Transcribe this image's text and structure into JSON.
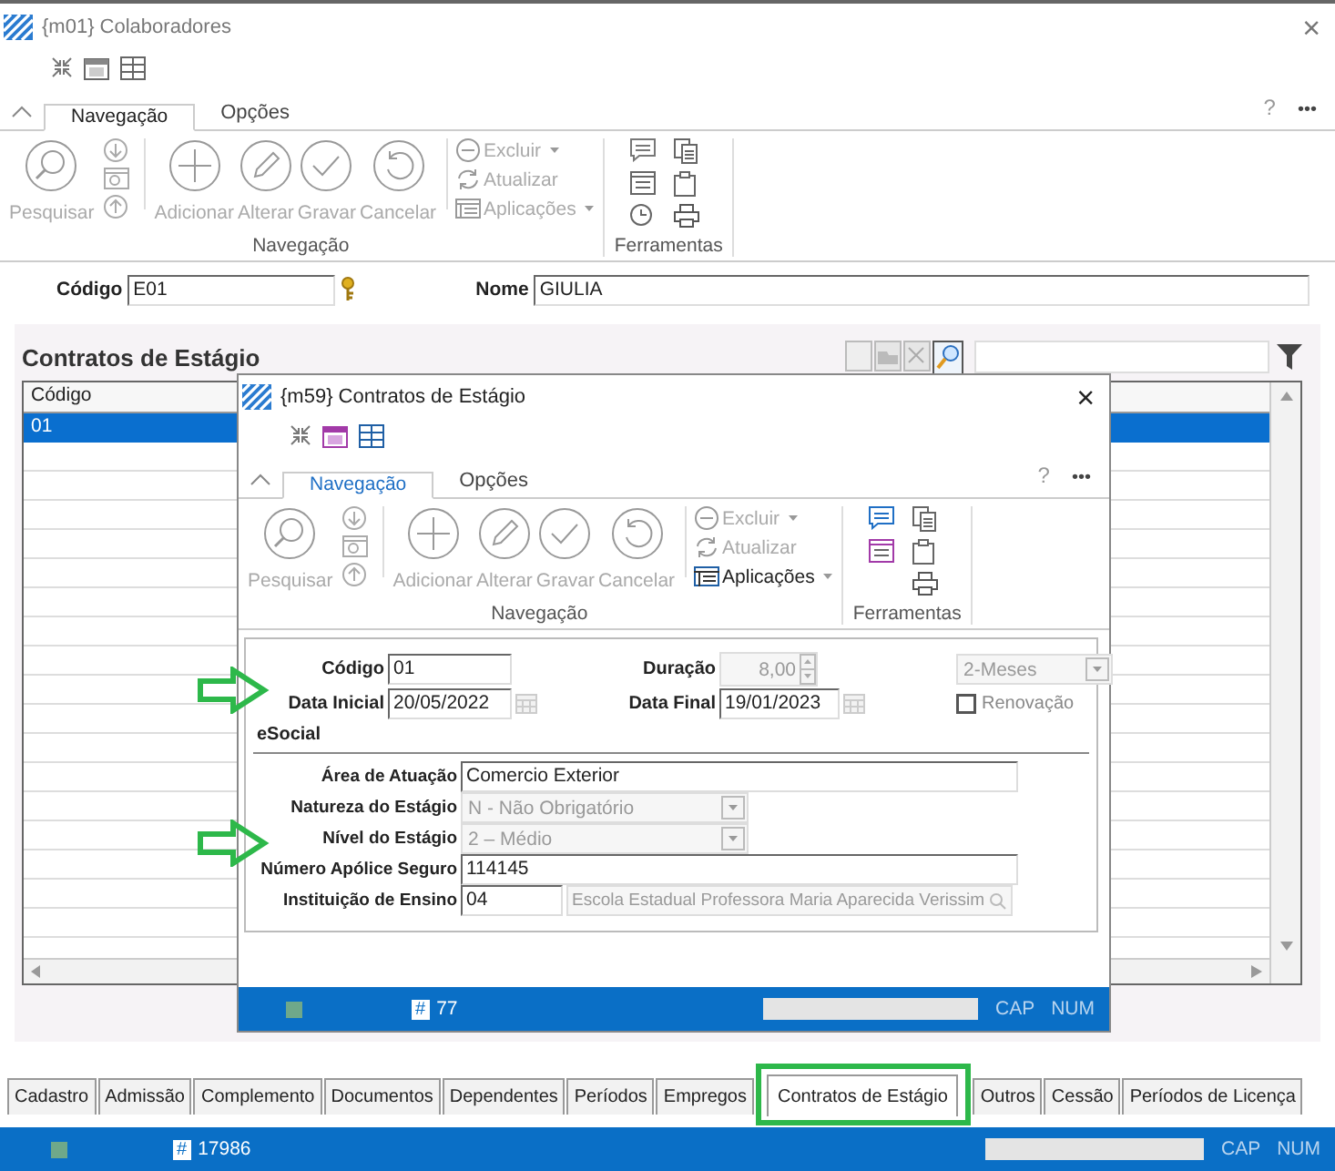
{
  "window": {
    "title": "{m01} Colaboradores",
    "close": "×"
  },
  "ribbon": {
    "focused": false,
    "help": "?",
    "more": "•••",
    "tabs": [
      {
        "label": "Navegação",
        "selected": true
      },
      {
        "label": "Opções",
        "selected": false
      }
    ],
    "big_buttons": [
      {
        "label": "Pesquisar",
        "disabled": true
      },
      {
        "label": "Adicionar",
        "disabled": true
      },
      {
        "label": "Alterar",
        "disabled": true
      },
      {
        "label": "Gravar",
        "disabled": true
      },
      {
        "label": "Cancelar",
        "disabled": true
      }
    ],
    "small_buttons": [
      {
        "label": "Excluir",
        "disabled": true
      },
      {
        "label": "Atualizar",
        "disabled": true
      },
      {
        "label": "Aplicações",
        "disabled": true
      }
    ],
    "groups": [
      "Navegação",
      "Ferramentas"
    ]
  },
  "header_fields": [
    {
      "label": "Código",
      "value": "E01",
      "kind": "key"
    },
    {
      "label": "Nome",
      "value": "GIULIA",
      "kind": "text"
    }
  ],
  "panel": {
    "title": "Contratos de Estágio",
    "columns": [
      "Código"
    ],
    "rows": [
      {
        "cells": [
          "01"
        ],
        "selected": true
      }
    ]
  },
  "dialog": {
    "title": "{m59}  Contratos de Estágio",
    "close": "×",
    "ribbon": {
      "focused": true,
      "help": "?",
      "more": "•••",
      "tabs": [
        {
          "label": "Navegação",
          "selected": true
        },
        {
          "label": "Opções",
          "selected": false
        }
      ],
      "big_buttons": [
        {
          "label": "Pesquisar",
          "disabled": true
        },
        {
          "label": "Adicionar",
          "disabled": true
        },
        {
          "label": "Alterar",
          "disabled": true
        },
        {
          "label": "Gravar",
          "disabled": true
        },
        {
          "label": "Cancelar",
          "disabled": true
        }
      ],
      "small_buttons": [
        {
          "label": "Excluir",
          "disabled": true
        },
        {
          "label": "Atualizar",
          "disabled": true
        },
        {
          "label": "Aplicações",
          "disabled": false
        }
      ],
      "groups": [
        "Navegação",
        "Ferramentas"
      ]
    },
    "form": {
      "codigo": {
        "label": "Código",
        "value": "01"
      },
      "duracao": {
        "label": "Duração",
        "value": "8,00"
      },
      "unidade": {
        "value": "2-Meses"
      },
      "data_inicial": {
        "label": "Data Inicial",
        "value": "20/05/2022"
      },
      "data_final": {
        "label": "Data Final",
        "value": "19/01/2023"
      },
      "renovacao": {
        "label": "Renovação",
        "checked": false
      },
      "section": "eSocial",
      "rows": [
        {
          "label": "Área de Atuação",
          "value": "Comercio Exterior",
          "kind": "text",
          "disabled": false
        },
        {
          "label": "Natureza do Estágio",
          "value": "N - Não Obrigatório",
          "kind": "select",
          "disabled": true
        },
        {
          "label": "Nível do Estágio",
          "value": "2 – Médio",
          "kind": "select",
          "disabled": true
        },
        {
          "label": "Número Apólice Seguro",
          "value": "114145",
          "kind": "text",
          "disabled": false
        },
        {
          "label": "Instituição de Ensino",
          "value": "04",
          "kind": "lookup",
          "disabled": false,
          "description": "Escola Estadual Professora Maria Aparecida Verissim"
        }
      ]
    },
    "status_bar": {
      "count_icon": "#",
      "count": "77",
      "indicators": [
        "CAP",
        "NUM"
      ]
    }
  },
  "bottom_tabs": [
    {
      "label": "Cadastro",
      "selected": false,
      "highlighted": false
    },
    {
      "label": "Admissão",
      "selected": false,
      "highlighted": false
    },
    {
      "label": "Complemento",
      "selected": false,
      "highlighted": false
    },
    {
      "label": "Documentos",
      "selected": false,
      "highlighted": false
    },
    {
      "label": "Dependentes",
      "selected": false,
      "highlighted": false
    },
    {
      "label": "Períodos",
      "selected": false,
      "highlighted": false
    },
    {
      "label": "Empregos",
      "selected": false,
      "highlighted": false
    },
    {
      "label": "Contratos de Estágio",
      "selected": true,
      "highlighted": true
    },
    {
      "label": "Outros",
      "selected": false,
      "highlighted": false
    },
    {
      "label": "Cessão",
      "selected": false,
      "highlighted": false
    },
    {
      "label": "Períodos de Licença",
      "selected": false,
      "highlighted": false
    }
  ],
  "status_bar": {
    "count_icon": "#",
    "count": "17986",
    "indicators": [
      "CAP",
      "NUM"
    ]
  }
}
